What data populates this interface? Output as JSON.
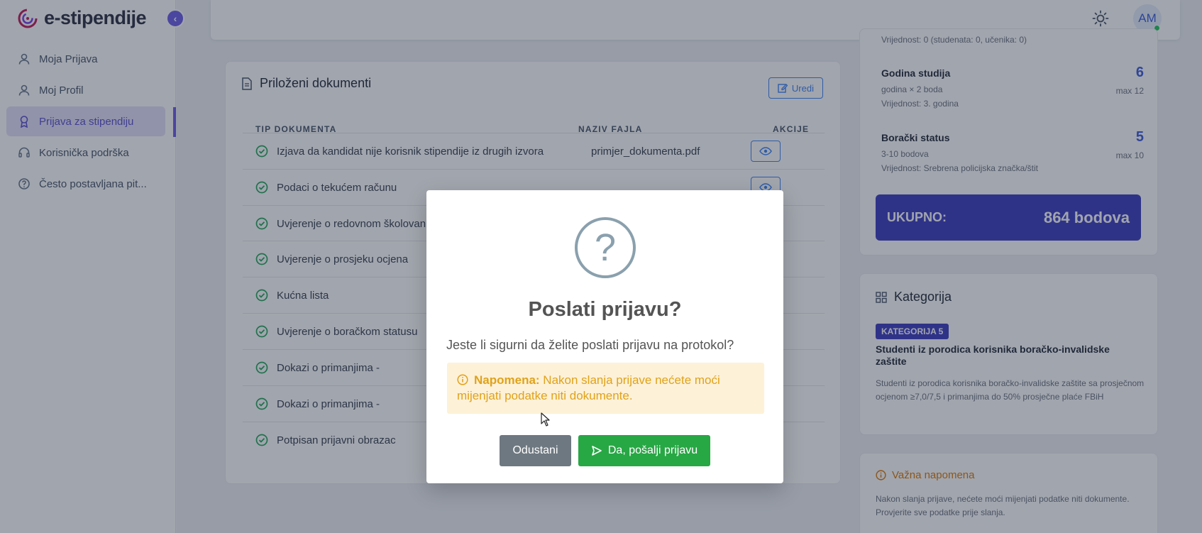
{
  "app": {
    "brand": "e-stipendije",
    "collapse_icon": "chevron-left-icon"
  },
  "sidebar": {
    "items": [
      {
        "label": "Moja Prijava",
        "icon": "user-icon"
      },
      {
        "label": "Moj Profil",
        "icon": "user-icon"
      },
      {
        "label": "Prijava za stipendiju",
        "icon": "award-icon",
        "active": true
      },
      {
        "label": "Korisnička podrška",
        "icon": "headset-icon"
      },
      {
        "label": "Često postavljana pit...",
        "icon": "help-circle-icon"
      }
    ]
  },
  "topbar": {
    "avatar_initials": "AM",
    "theme_icon": "sun-icon"
  },
  "documents": {
    "title": "Priloženi dokumenti",
    "edit_label": "Uredi",
    "columns": [
      "TIP DOKUMENTA",
      "NAZIV FAJLA",
      "AKCIJE"
    ],
    "rows": [
      {
        "type": "Izjava da kandidat nije korisnik stipendije iz drugih izvora",
        "file": "primjer_dokumenta.pdf"
      },
      {
        "type": "Podaci o tekućem računu",
        "file": ""
      },
      {
        "type": "Uvjerenje o redovnom školovan",
        "file": ""
      },
      {
        "type": "Uvjerenje o prosjeku ocjena",
        "file": ""
      },
      {
        "type": "Kućna lista",
        "file": ""
      },
      {
        "type": "Uvjerenje o boračkom statusu",
        "file": ""
      },
      {
        "type": "Dokazi o primanjima -",
        "file": ""
      },
      {
        "type": "Dokazi o primanjima -",
        "file": ""
      },
      {
        "type": "Potpisan prijavni obrazac",
        "file": ""
      }
    ]
  },
  "scoring": {
    "top_partial": "Vrijednost: 0 (studenata: 0, učenika: 0)",
    "criteria": [
      {
        "title": "Godina studija",
        "formula": "godina × 2 boda",
        "value": "Vrijednost: 3. godina",
        "score": "6",
        "max": "max 12"
      },
      {
        "title": "Borački status",
        "formula": "3-10 bodova",
        "value": "Vrijednost: Srebrena policijska značka/štit",
        "score": "5",
        "max": "max 10"
      }
    ],
    "total_label": "UKUPNO:",
    "total_value": "864 bodova"
  },
  "category": {
    "title": "Kategorija",
    "badge": "KATEGORIJA 5",
    "name": "Studenti iz porodica korisnika boračko-invalidske zaštite",
    "description": "Studenti iz porodica korisnika boračko-invalidske zaštite sa prosječnom ocjenom ≥7,0/7,5 i primanjima do 50% prosječne plaće FBiH"
  },
  "important_note": {
    "title": "Važna napomena",
    "text": "Nakon slanja prijave, nećete moći mijenjati podatke niti dokumente. Provjerite sve podatke prije slanja."
  },
  "modal": {
    "icon": "?",
    "title": "Poslati prijavu?",
    "message": "Jeste li sigurni da želite poslati prijavu na protokol?",
    "warning_label": "Napomena:",
    "warning_text": " Nakon slanja prijave nećete moći mijenjati podatke niti dokumente.",
    "cancel_label": "Odustani",
    "confirm_label": "Da, pošalji prijavu"
  },
  "colors": {
    "accent": "#6b5ce7",
    "primary_blue": "#3b3bbf",
    "success": "#28a745",
    "warning_bg": "#fdf1d7",
    "warning_text": "#e0a21a"
  }
}
